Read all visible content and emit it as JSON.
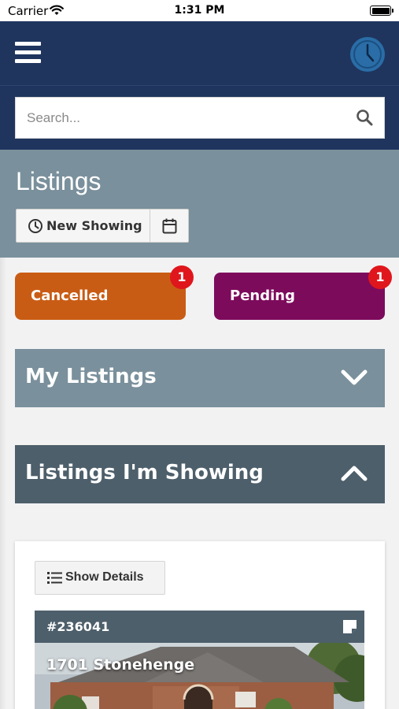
{
  "status_bar": {
    "carrier": "Carrier",
    "time": "1:31 PM"
  },
  "navbar": {
    "menu_icon": "hamburger-menu-icon",
    "clock_icon": "clock-icon"
  },
  "search": {
    "placeholder": "Search..."
  },
  "page": {
    "title": "Listings"
  },
  "toolbar": {
    "new_showing_label": "New Showing",
    "calendar_icon": "calendar-icon"
  },
  "status_buttons": [
    {
      "label": "Cancelled",
      "count": "1",
      "color": "#c95c14"
    },
    {
      "label": "Pending",
      "count": "1",
      "color": "#7d0b5c"
    }
  ],
  "accordions": [
    {
      "label": "My Listings",
      "state": "collapsed",
      "color": "#7a909c"
    },
    {
      "label": "Listings I'm Showing",
      "state": "expanded",
      "color": "#4d5f6b"
    }
  ],
  "card": {
    "details_label": "Show Details",
    "listing_number": "#236041",
    "address": "1701 Stonehenge"
  },
  "colors": {
    "navbar": "#1f355e",
    "header_band": "#7a909c",
    "badge": "#e0161d"
  }
}
